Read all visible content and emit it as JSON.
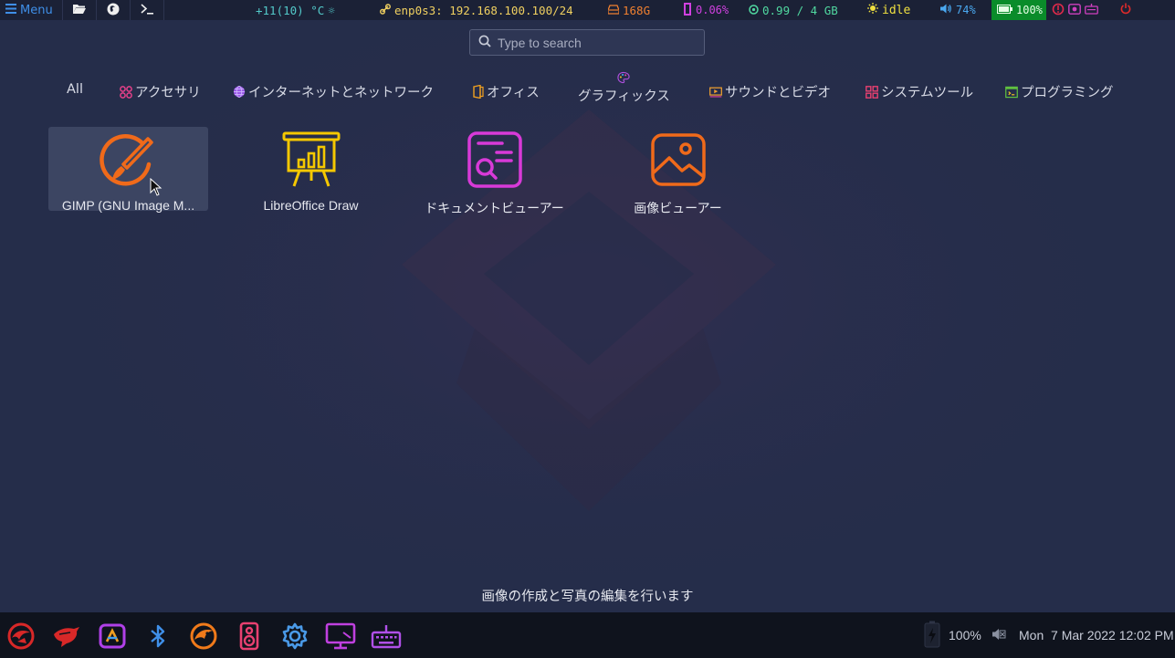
{
  "topbar": {
    "menu_label": "Menu",
    "temperature": "+11(10) °C",
    "network": "enp0s3: 192.168.100.100/24",
    "disk": "168G",
    "cpu": "0.06%",
    "memory": "0.99 / 4 GB",
    "idle": "idle",
    "volume": "74%",
    "battery": "100%"
  },
  "search": {
    "placeholder": "Type to search"
  },
  "categories": [
    {
      "label": "All",
      "icon": "all"
    },
    {
      "label": "アクセサリ",
      "icon": "accessories-icon"
    },
    {
      "label": "インターネットとネットワーク",
      "icon": "globe-icon"
    },
    {
      "label": "オフィス",
      "icon": "office-icon"
    },
    {
      "label": "グラフィックス",
      "icon": "palette-icon"
    },
    {
      "label": "サウンドとビデオ",
      "icon": "video-icon"
    },
    {
      "label": "システムツール",
      "icon": "system-tools-icon"
    },
    {
      "label": "プログラミング",
      "icon": "programming-icon"
    }
  ],
  "apps": [
    {
      "label": "GIMP (GNU Image M...",
      "icon": "gimp-icon"
    },
    {
      "label": "LibreOffice Draw",
      "icon": "presentation-chart-icon"
    },
    {
      "label": "ドキュメントビューアー",
      "icon": "document-viewer-icon"
    },
    {
      "label": "画像ビューアー",
      "icon": "image-viewer-icon"
    }
  ],
  "description": "画像の作成と写真の編集を行います",
  "bottombar": {
    "battery": "100%",
    "datetime": "Mon  7 Mar 2022 12:02 PM"
  },
  "colors": {
    "background": "#252d4a",
    "panel": "#1b2136",
    "accent_blue": "#3f8fe8",
    "gimp_orange": "#f06a1a",
    "draw_yellow": "#f5c800",
    "doc_magenta": "#d83ad8"
  }
}
